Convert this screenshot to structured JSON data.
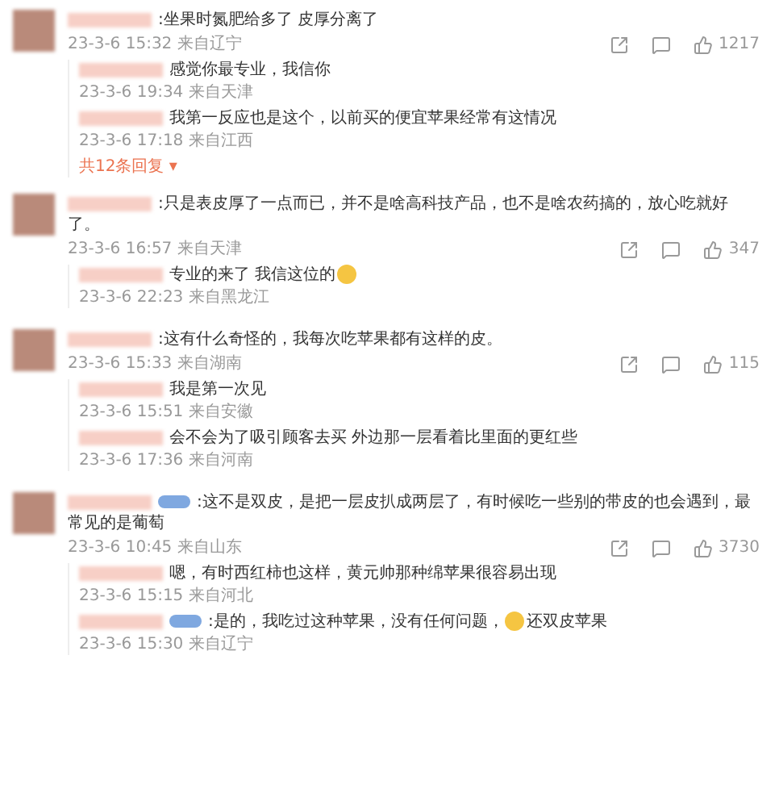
{
  "comments": [
    {
      "name_badge": false,
      "text": ":坐果时氮肥给多了 皮厚分离了",
      "time": "23-3-6 15:32 来自辽宁",
      "likes": "1217",
      "replies": [
        {
          "name_badge": false,
          "text": "感觉你最专业，我信你",
          "emoji": false,
          "time": "23-3-6 19:34 来自天津"
        },
        {
          "name_badge": false,
          "text": "我第一反应也是这个，以前买的便宜苹果经常有这情况",
          "emoji": false,
          "time": "23-3-6 17:18 来自江西"
        }
      ],
      "more": "共12条回复 ▾"
    },
    {
      "name_badge": false,
      "text": ":只是表皮厚了一点而已，并不是啥高科技产品，也不是啥农药搞的，放心吃就好了。",
      "time": "23-3-6 16:57 来自天津",
      "likes": "347",
      "replies": [
        {
          "name_badge": false,
          "text": "专业的来了 我信这位的",
          "emoji": true,
          "time": "23-3-6 22:23 来自黑龙江"
        }
      ]
    },
    {
      "name_badge": false,
      "text": ":这有什么奇怪的，我每次吃苹果都有这样的皮。",
      "time": "23-3-6 15:33 来自湖南",
      "likes": "115",
      "replies": [
        {
          "name_badge": false,
          "text": "我是第一次见",
          "emoji": false,
          "time": "23-3-6 15:51 来自安徽"
        },
        {
          "name_badge": false,
          "text": "会不会为了吸引顾客去买 外边那一层看着比里面的更红些",
          "emoji": false,
          "time": "23-3-6 17:36 来自河南"
        }
      ]
    },
    {
      "name_badge": true,
      "text": ":这不是双皮，是把一层皮扒成两层了，有时候吃一些别的带皮的也会遇到，最常见的是葡萄",
      "time": "23-3-6 10:45 来自山东",
      "likes": "3730",
      "replies": [
        {
          "name_badge": false,
          "text": "嗯，有时西红柿也这样，黄元帅那种绵苹果很容易出现",
          "emoji": false,
          "time": "23-3-6 15:15 来自河北"
        },
        {
          "name_badge": true,
          "text": ":是的，我吃过这种苹果，没有任何问题，",
          "emoji": true,
          "text_after": "还双皮苹果",
          "time": "23-3-6 15:30 来自辽宁"
        }
      ]
    }
  ]
}
